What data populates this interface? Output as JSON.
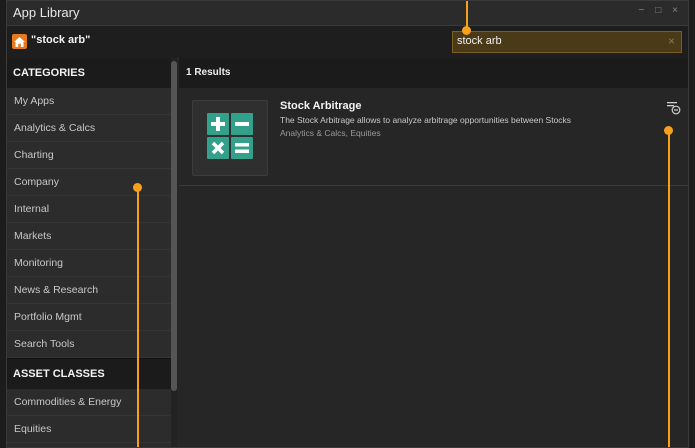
{
  "window": {
    "title": "App Library",
    "controls": [
      "−",
      "□",
      "×"
    ]
  },
  "search": {
    "query_title": "\"stock arb\"",
    "value": "stock arb",
    "clear": "×"
  },
  "sidebar": {
    "categories_header": "CATEGORIES",
    "categories": [
      "My Apps",
      "Analytics & Calcs",
      "Charting",
      "Company",
      "Internal",
      "Markets",
      "Monitoring",
      "News & Research",
      "Portfolio Mgmt",
      "Search Tools"
    ],
    "asset_classes_header": "ASSET CLASSES",
    "asset_classes": [
      "Commodities & Energy",
      "Equities"
    ]
  },
  "results": {
    "count_label": "1 Results",
    "items": [
      {
        "name": "Stock Arbitrage",
        "description": "The Stock Arbitrage allows to analyze arbitrage opportunities between Stocks",
        "tags": "Analytics & Calcs, Equities",
        "icon": "calculator-grid-icon"
      }
    ]
  },
  "colors": {
    "accent": "#f5a21a",
    "home": "#e7791d",
    "tile": "#33a08c",
    "search_bg": "#4a3a17"
  }
}
